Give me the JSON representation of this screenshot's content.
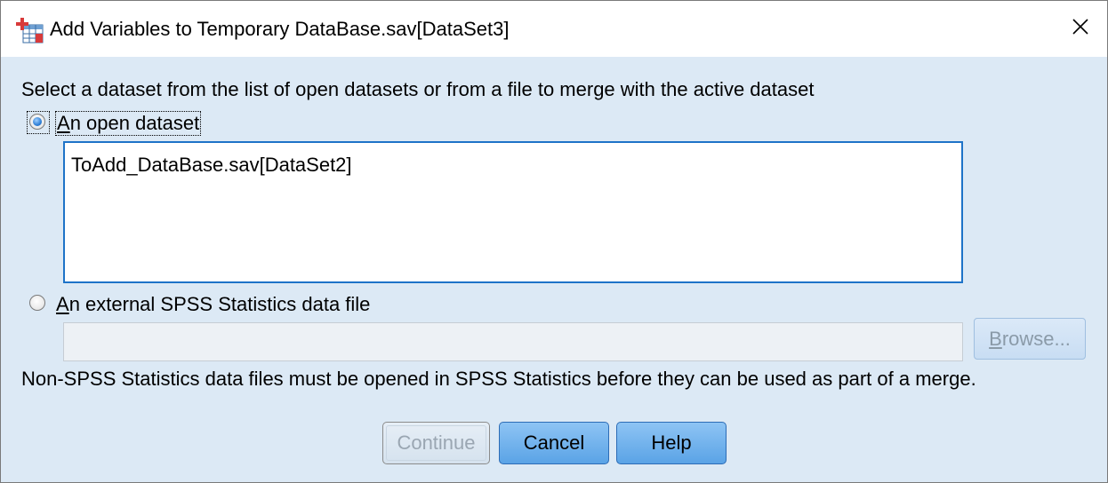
{
  "window": {
    "title": "Add Variables to Temporary DataBase.sav[DataSet3]",
    "app_icon": "spss-data-editor-icon",
    "close_icon": "close-icon"
  },
  "instruction": "Select a dataset from the list of open datasets or from a file to merge with the active dataset",
  "options": {
    "open_dataset": {
      "label_mnemonic": "A",
      "label_rest": "n open dataset",
      "selected": true
    },
    "external_file": {
      "label_mnemonic": "A",
      "label_rest": "n external SPSS Statistics data file",
      "selected": false
    }
  },
  "dataset_list": {
    "items": [
      "ToAdd_DataBase.sav[DataSet2]"
    ]
  },
  "file_input": {
    "value": ""
  },
  "browse_button": {
    "mnemonic": "B",
    "rest": "rowse...",
    "enabled": false
  },
  "note": "Non-SPSS Statistics data files must be opened in SPSS Statistics before they can be used as part of a merge.",
  "buttons": {
    "continue": "Continue",
    "cancel": "Cancel",
    "help": "Help"
  },
  "colors": {
    "dialog_bg": "#dce9f5",
    "accent_border": "#1e73c8",
    "button_blue": "#5aa3e6"
  }
}
